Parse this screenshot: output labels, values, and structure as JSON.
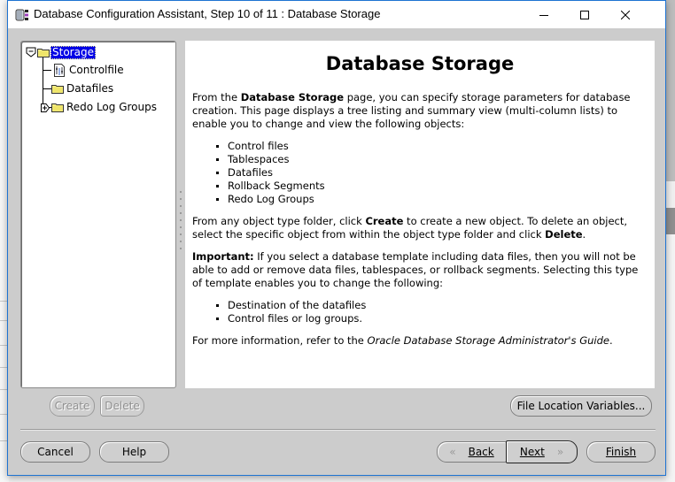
{
  "window": {
    "title": "Database Configuration Assistant, Step 10 of 11 : Database Storage",
    "icon": "database-app-icon",
    "controls": {
      "minimize": "minimize-icon",
      "maximize": "maximize-icon",
      "close": "close-icon"
    }
  },
  "tree": {
    "root": {
      "label": "Storage",
      "expanded": true,
      "selected": true,
      "icon": "folder-icon"
    },
    "children": [
      {
        "label": "Controlfile",
        "icon": "controlfile-icon",
        "expandable": false
      },
      {
        "label": "Datafiles",
        "icon": "folder-icon",
        "expandable": false
      },
      {
        "label": "Redo Log Groups",
        "icon": "folder-icon",
        "expandable": true,
        "expanded": false
      }
    ]
  },
  "content": {
    "heading": "Database Storage",
    "p1": {
      "before": "From the ",
      "bold": "Database Storage",
      "after": " page, you can specify storage parameters for database creation. This page displays a tree listing and summary view (multi-column lists) to enable you to change and view the following objects:"
    },
    "objects_list": [
      "Control files",
      "Tablespaces",
      "Datafiles",
      "Rollback Segments",
      "Redo Log Groups"
    ],
    "p2": {
      "t1": "From any object type folder, click ",
      "b1": "Create",
      "t2": " to create a new object. To delete an object, select the specific object from within the object type folder and click ",
      "b2": "Delete",
      "t3": "."
    },
    "p3": {
      "bold": "Important:",
      "text": " If you select a database template including data files, then you will not be able to add or remove data files, tablespaces, or rollback segments. Selecting this type of template enables you to change the following:"
    },
    "template_list": [
      "Destination of the datafiles",
      "Control files or log groups."
    ],
    "p4": {
      "before": "For more information, refer to the ",
      "italic": "Oracle Database Storage Administrator's Guide",
      "after": "."
    }
  },
  "buttons": {
    "create": "Create",
    "delete": "Delete",
    "file_location_variables": "File Location Variables...",
    "cancel": "Cancel",
    "help": "Help",
    "back": "Back",
    "next": "Next",
    "finish": "Finish"
  },
  "colors": {
    "selection": "#0000e6",
    "window_border": "#1e73d2",
    "dialog_bg": "#cccccc",
    "folder_fill": "#f5ef8a"
  }
}
